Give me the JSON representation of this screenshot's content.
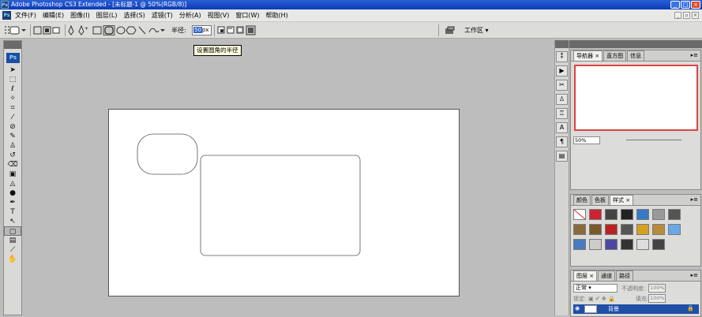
{
  "window": {
    "title": "Adobe Photoshop CS3 Extended - [未标题-1 @ 50%(RGB/8)]",
    "logo": "Ps"
  },
  "menu": [
    "文件(F)",
    "编辑(E)",
    "图像(I)",
    "图层(L)",
    "选择(S)",
    "滤镜(T)",
    "分析(A)",
    "视图(V)",
    "窗口(W)",
    "帮助(H)"
  ],
  "options": {
    "radius_label": "半径:",
    "radius_value": "50",
    "radius_unit": "px",
    "workspace_label": "工作区",
    "tooltip": "设置圆角的半径"
  },
  "toolbox": {
    "logo": "Ps",
    "tools": [
      "move-tool",
      "marquee-tool",
      "lasso-tool",
      "magic-wand-tool",
      "crop-tool",
      "slice-tool",
      "healing-brush-tool",
      "brush-tool",
      "clone-stamp-tool",
      "history-brush-tool",
      "eraser-tool",
      "gradient-tool",
      "blur-tool",
      "dodge-tool",
      "pen-tool",
      "type-tool",
      "path-selection-tool",
      "rounded-rectangle-tool",
      "notes-tool",
      "eyedropper-tool",
      "hand-tool"
    ]
  },
  "panels": {
    "navigator": {
      "tabs": [
        "导航器",
        "直方图",
        "信息"
      ],
      "zoom": "50%"
    },
    "swatches": {
      "tabs": [
        "颜色",
        "色板",
        "样式"
      ]
    },
    "layers": {
      "tabs": [
        "图层",
        "通道",
        "路径"
      ],
      "blend_mode": "正常",
      "opacity_label": "不透明度:",
      "opacity_value": "100%",
      "lock_label": "锁定:",
      "fill_label": "填充:",
      "fill_value": "100%",
      "layer_name": "背景"
    }
  },
  "colors": {
    "titlebar": "#0b3bb8",
    "canvas_bg": "#ffffff",
    "workspace_bg": "#bdbdbd",
    "nav_view_box": "#dd4444"
  }
}
